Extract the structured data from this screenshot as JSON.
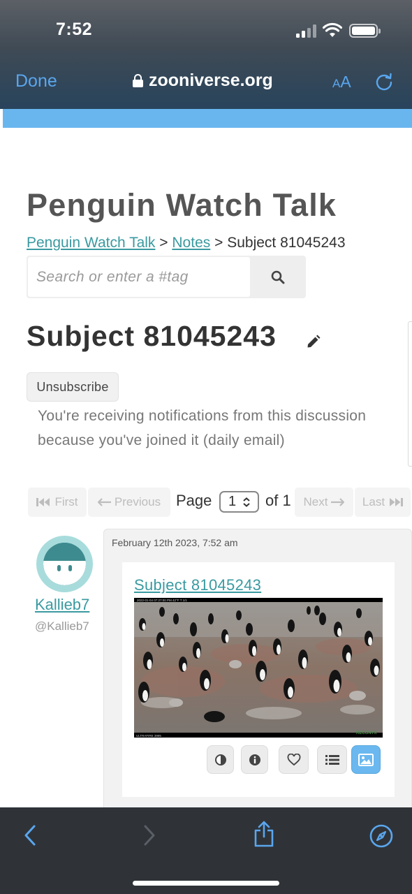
{
  "status_bar": {
    "time": "7:52"
  },
  "browser": {
    "done_label": "Done",
    "url": "zooniverse.org",
    "text_size_small": "A",
    "text_size_large": "A"
  },
  "site": {
    "title": "Penguin Watch Talk"
  },
  "breadcrumb": {
    "root": "Penguin Watch Talk",
    "sep1": ">",
    "section": "Notes",
    "sep2": ">",
    "current": "Subject 81045243"
  },
  "search": {
    "placeholder": "Search or enter a #tag",
    "icon": "search-icon"
  },
  "discussion": {
    "title": "Subject 81045243",
    "unsubscribe_label": "Unsubscribe",
    "notification_text": "You're receiving notifications from this discussion because you've joined it (daily email)"
  },
  "pagination": {
    "first": "First",
    "previous": "Previous",
    "page_label": "Page",
    "current_page": "1",
    "of_label": "of 1",
    "next": "Next",
    "last": "Last"
  },
  "comment": {
    "display_name": "Kallieb7",
    "handle": "@Kallieb7",
    "timestamp": "February 12th 2023, 7:52 am",
    "subject_link": "Subject 81045243",
    "image_caption_top": "2022-01-04 07:27:00 PM      42°F   T 1/1",
    "image_caption_bottom": "ULTRAFIRE 3995",
    "image_brand": "RECONYX",
    "toolbar": [
      "invert-icon",
      "info-icon",
      "heart-icon",
      "list-icon",
      "image-icon"
    ]
  },
  "colors": {
    "accent_teal": "#3a9aa0",
    "safari_blue": "#5aa6ee",
    "band_blue": "#69b6ef"
  }
}
